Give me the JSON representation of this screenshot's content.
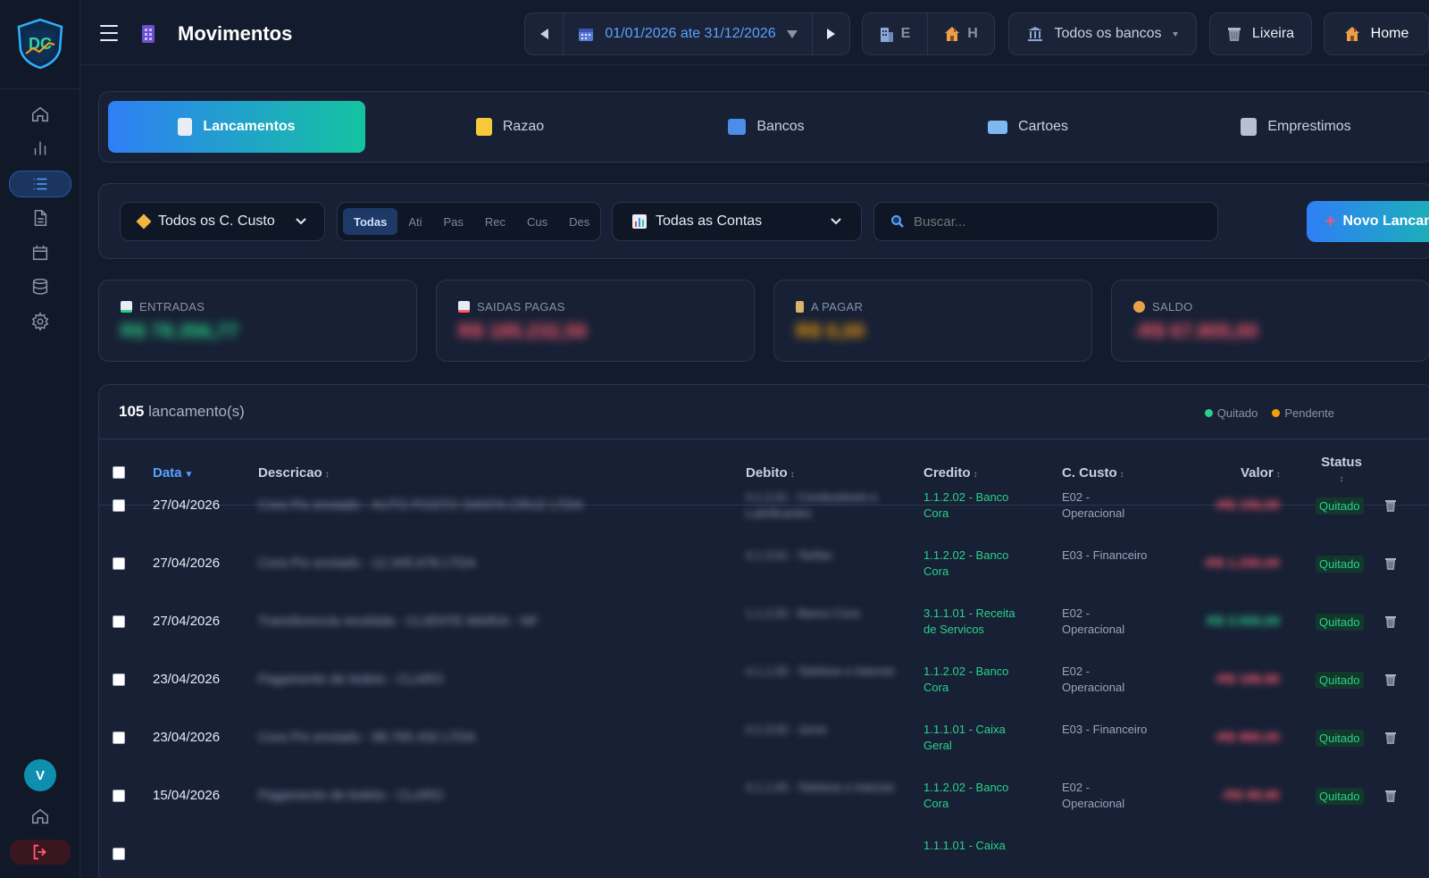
{
  "app": {
    "title": "Movimentos",
    "logo_text": "DC"
  },
  "topbar": {
    "date_range": "01/01/2026 ate 31/12/2026",
    "company_e": "E",
    "company_h": "H",
    "bank_filter": "Todos os bancos",
    "trash_label": "Lixeira",
    "home_label": "Home"
  },
  "sidebar": {
    "items": [
      {
        "name": "home",
        "icon": "home-icon"
      },
      {
        "name": "reports",
        "icon": "bar-chart-icon"
      },
      {
        "name": "movements",
        "icon": "list-icon",
        "active": true
      },
      {
        "name": "documents",
        "icon": "document-icon"
      },
      {
        "name": "calendar",
        "icon": "calendar-icon"
      },
      {
        "name": "database",
        "icon": "database-icon"
      },
      {
        "name": "settings",
        "icon": "gear-icon"
      }
    ],
    "avatar_initial": "V"
  },
  "tabs": [
    {
      "label": "Lancamentos",
      "active": true
    },
    {
      "label": "Razao"
    },
    {
      "label": "Bancos"
    },
    {
      "label": "Cartoes"
    },
    {
      "label": "Emprestimos"
    }
  ],
  "filters": {
    "cost_center": "Todos os C. Custo",
    "segments": [
      "Todas",
      "Ati",
      "Pas",
      "Rec",
      "Cus",
      "Des"
    ],
    "active_segment": "Todas",
    "accounts": "Todas as Contas",
    "search_placeholder": "Buscar...",
    "new_button": "Novo Lancamento"
  },
  "stats": {
    "entradas": {
      "label": "ENTRADAS",
      "value": "R$ 78.356,77",
      "color": "#2bd18a"
    },
    "saidas": {
      "label": "SAIDAS PAGAS",
      "value": "R$ 185.232,50",
      "color": "#ff5a6e"
    },
    "a_pagar": {
      "label": "A PAGAR",
      "value": "R$ 0,00",
      "color": "#f59e0b"
    },
    "saldo": {
      "label": "SALDO",
      "value": "-R$ 67.805,00",
      "color": "#ff5a6e"
    }
  },
  "table": {
    "count": "105",
    "count_suffix": "lancamento(s)",
    "legend_paid": "Quitado",
    "legend_pending": "Pendente",
    "columns": {
      "date": "Data",
      "description": "Descricao",
      "debit": "Debito",
      "credit": "Credito",
      "cost_center": "C. Custo",
      "value": "Valor",
      "status": "Status"
    },
    "rows": [
      {
        "date": "27/04/2026",
        "description": "Cora Pix enviado - AUTO POSTO SANTA CRUZ LTDA",
        "debit": "4.1.2.01 - Combustiveis e Lubrificantes",
        "credit": "1.1.2.02 - Banco Cora",
        "cost_center": "E02 - Operacional",
        "value": "-R$ 150,00",
        "status": "Quitado"
      },
      {
        "date": "27/04/2026",
        "description": "Cora Pix enviado - 12.345.678 LTDA",
        "debit": "4.1.3.01 - Tarifas",
        "credit": "1.1.2.02 - Banco Cora",
        "cost_center": "E03 - Financeiro",
        "value": "-R$ 1.250,00",
        "status": "Quitado"
      },
      {
        "date": "27/04/2026",
        "description": "Transferencia recebida - CLIENTE MARIA - NF",
        "debit": "1.1.2.02 - Banco Cora",
        "credit": "3.1.1.01 - Receita de Servicos",
        "cost_center": "E02 - Operacional",
        "value": "R$ 3.500,00",
        "status": "Quitado"
      },
      {
        "date": "23/04/2026",
        "description": "Pagamento de boleto - CLARO",
        "debit": "4.1.1.05 - Telefone e Internet",
        "credit": "1.1.2.02 - Banco Cora",
        "cost_center": "E02 - Operacional",
        "value": "-R$ 189,90",
        "status": "Quitado"
      },
      {
        "date": "23/04/2026",
        "description": "Cora Pix enviado - 98.765.432 LTDA",
        "debit": "4.1.3.02 - Juros",
        "credit": "1.1.1.01 - Caixa Geral",
        "cost_center": "E03 - Financeiro",
        "value": "-R$ 980,00",
        "status": "Quitado"
      },
      {
        "date": "15/04/2026",
        "description": "Pagamento de boleto - CLARO",
        "debit": "4.1.1.05 - Telefone e Internet",
        "credit": "1.1.2.02 - Banco Cora",
        "cost_center": "E02 - Operacional",
        "value": "-R$ 99,90",
        "status": "Quitado"
      },
      {
        "date": "",
        "description": "",
        "debit": "",
        "credit": "1.1.1.01 - Caixa",
        "cost_center": "",
        "value": "",
        "status": ""
      }
    ]
  },
  "colors": {
    "accent_blue": "#2f7ff5",
    "accent_green": "#14c3a0",
    "paid": "#2bd18a",
    "pending": "#f59e0b",
    "negative": "#ff5a6e"
  }
}
